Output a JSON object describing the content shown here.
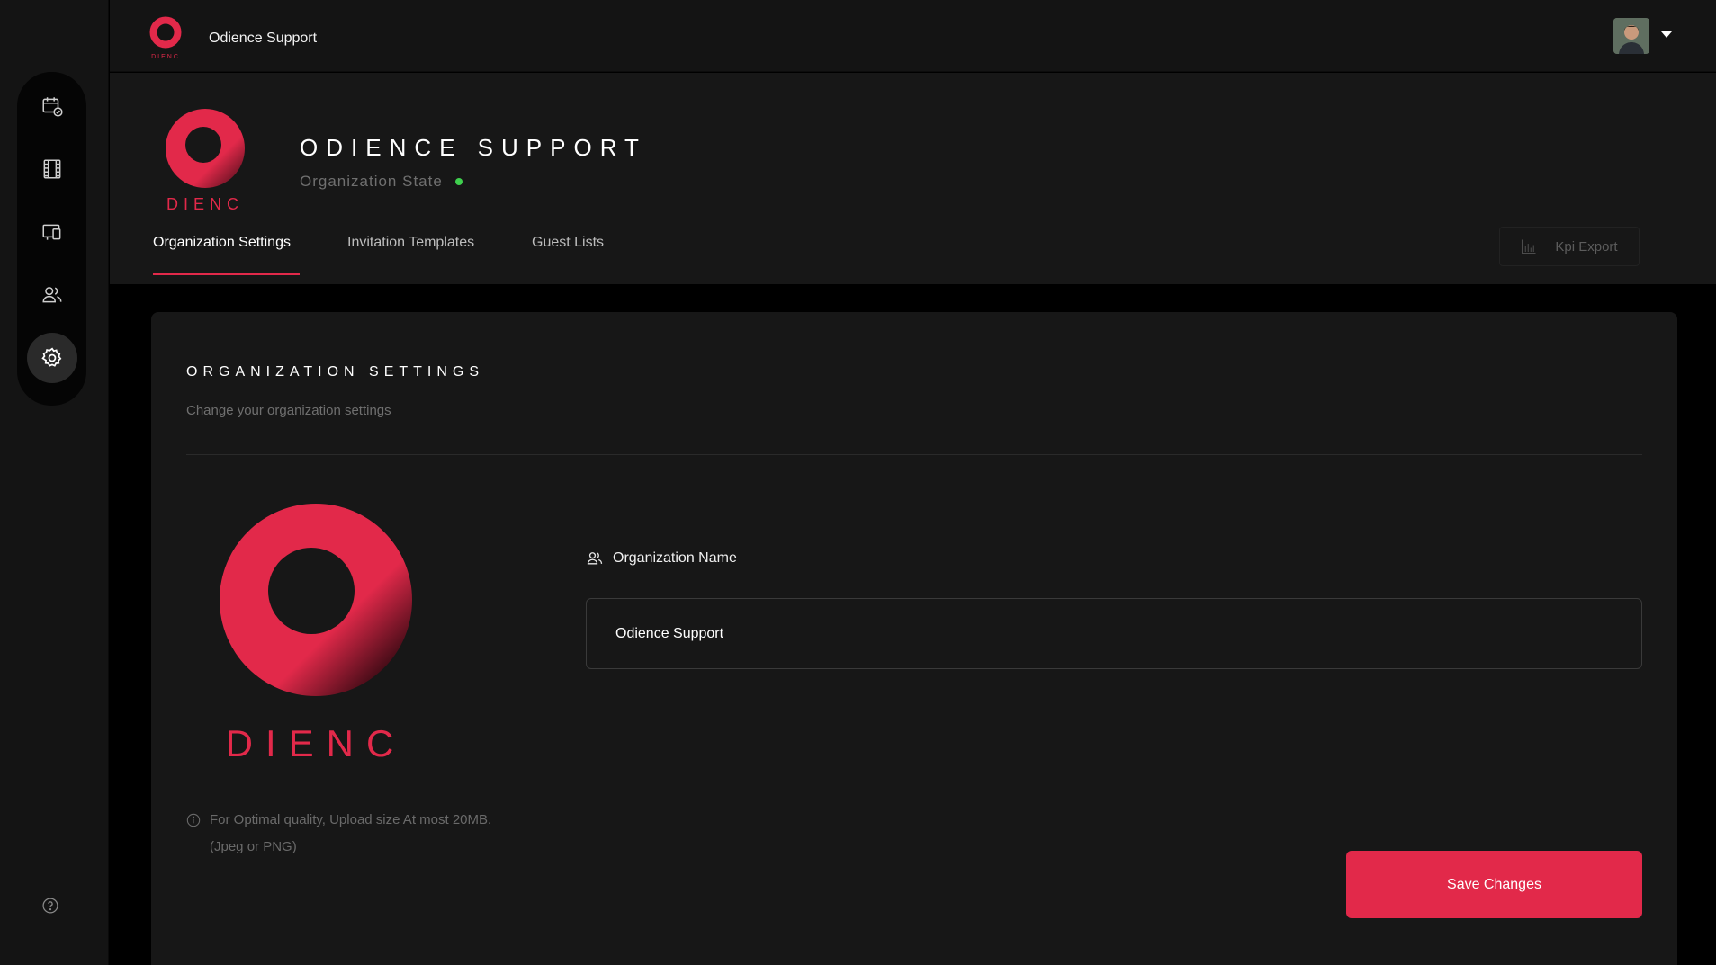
{
  "topbar": {
    "title": "Odience Support",
    "avatar_alt": "user avatar"
  },
  "sidebar": {
    "items": [
      {
        "icon": "calendar-check-icon",
        "active": false
      },
      {
        "icon": "film-strip-icon",
        "active": false
      },
      {
        "icon": "devices-icon",
        "active": false
      },
      {
        "icon": "users-icon",
        "active": false
      },
      {
        "icon": "gear-icon",
        "active": true
      }
    ],
    "help_icon": "help-circle-icon"
  },
  "org": {
    "name": "ODIENCE SUPPORT",
    "state_label": "Organization State",
    "state_color": "#3fcf4e",
    "logo_text": "DIENC"
  },
  "tabs": [
    {
      "label": "Organization Settings",
      "active": true
    },
    {
      "label": "Invitation Templates",
      "active": false
    },
    {
      "label": "Guest Lists",
      "active": false
    }
  ],
  "kpi_export": {
    "label": "Kpi Export"
  },
  "settings": {
    "title": "ORGANIZATION SETTINGS",
    "subtitle": "Change your organization settings",
    "upload_note": "For Optimal quality, Upload size At most 20MB. (Jpeg or PNG)",
    "field_label": "Organization Name",
    "field_value": "Odience Support",
    "save_label": "Save Changes"
  },
  "colors": {
    "accent": "#e2294a",
    "background": "#000000",
    "panel": "#171717"
  }
}
